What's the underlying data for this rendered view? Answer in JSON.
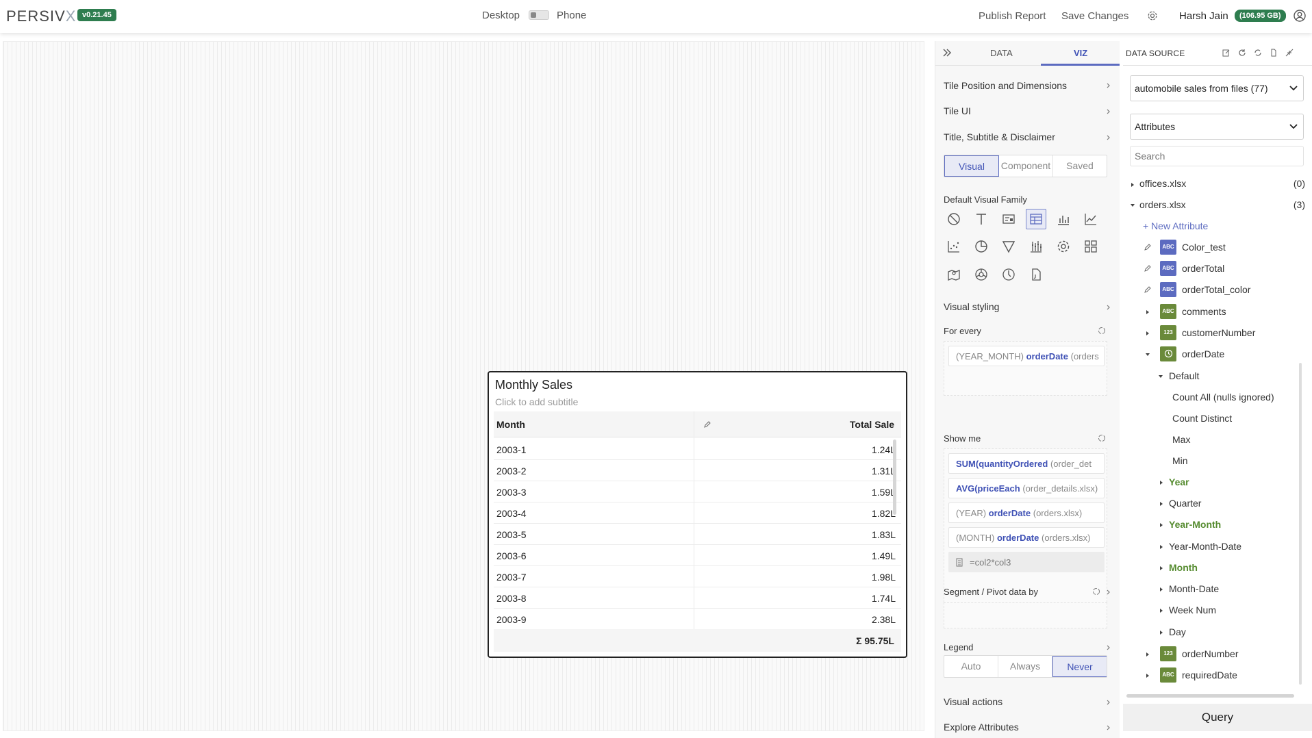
{
  "topbar": {
    "logo_main": "PERSIV",
    "logo_x": "X",
    "version": "v0.21.45",
    "mode_desktop": "Desktop",
    "mode_phone": "Phone",
    "publish": "Publish Report",
    "save": "Save Changes",
    "user": "Harsh Jain",
    "quota": "(106.95 GB)"
  },
  "tile": {
    "title": "Monthly Sales",
    "subtitle": "Click to add subtitle",
    "col_month": "Month",
    "col_total": "Total Sale",
    "rows": [
      {
        "month": "2003-1",
        "total": "1.24L"
      },
      {
        "month": "2003-2",
        "total": "1.31L"
      },
      {
        "month": "2003-3",
        "total": "1.59L"
      },
      {
        "month": "2003-4",
        "total": "1.82L"
      },
      {
        "month": "2003-5",
        "total": "1.83L"
      },
      {
        "month": "2003-6",
        "total": "1.49L"
      },
      {
        "month": "2003-7",
        "total": "1.98L"
      },
      {
        "month": "2003-8",
        "total": "1.74L"
      },
      {
        "month": "2003-9",
        "total": "2.38L"
      }
    ],
    "sum": "Σ 95.75L"
  },
  "panel": {
    "tab_data": "DATA",
    "tab_viz": "VIZ",
    "tile_position": "Tile Position and Dimensions",
    "tile_ui": "Tile UI",
    "title_sub": "Title, Subtitle & Disclaimer",
    "seg_visual": "Visual",
    "seg_component": "Component",
    "seg_saved": "Saved",
    "default_family": "Default Visual Family",
    "visual_styling": "Visual styling",
    "for_every": "For every",
    "for_every_prefix": "(YEAR_MONTH)",
    "for_every_field": "orderDate",
    "for_every_src": "(orders",
    "show_me": "Show me",
    "show": {
      "s1_fn": "SUM(",
      "s1_field": "quantityOrdered",
      "s1_src": "(order_det",
      "s2_fn": "AVG(",
      "s2_field": "priceEach",
      "s2_src": "(order_details.xlsx)",
      "s3_pre": "(YEAR)",
      "s3_field": "orderDate",
      "s3_src": "(orders.xlsx)",
      "s4_pre": "(MONTH)",
      "s4_field": "orderDate",
      "s4_src": "(orders.xlsx)",
      "s5": "=col2*col3"
    },
    "segment": "Segment / Pivot data by",
    "legend": "Legend",
    "legend_auto": "Auto",
    "legend_always": "Always",
    "legend_never": "Never",
    "visual_actions": "Visual actions",
    "explore": "Explore Attributes"
  },
  "datasource": {
    "header": "DATA SOURCE",
    "source": "automobile sales from files (77)",
    "attributes": "Attributes",
    "search_placeholder": "Search",
    "offices": "offices.xlsx",
    "offices_count": "(0)",
    "orders": "orders.xlsx",
    "orders_count": "(3)",
    "new_attr": "+ New Attribute",
    "color_test": "Color_test",
    "order_total": "orderTotal",
    "order_total_color": "orderTotal_color",
    "comments": "comments",
    "customer_number": "customerNumber",
    "order_date": "orderDate",
    "default": "Default",
    "count_all": "Count All (nulls ignored)",
    "count_distinct": "Count Distinct",
    "max": "Max",
    "min": "Min",
    "year": "Year",
    "quarter": "Quarter",
    "year_month": "Year-Month",
    "year_month_date": "Year-Month-Date",
    "month": "Month",
    "month_date": "Month-Date",
    "week_num": "Week Num",
    "day": "Day",
    "order_number": "orderNumber",
    "required_date": "requiredDate",
    "badge_abc": "ABC",
    "badge_123": "123",
    "query": "Query"
  }
}
